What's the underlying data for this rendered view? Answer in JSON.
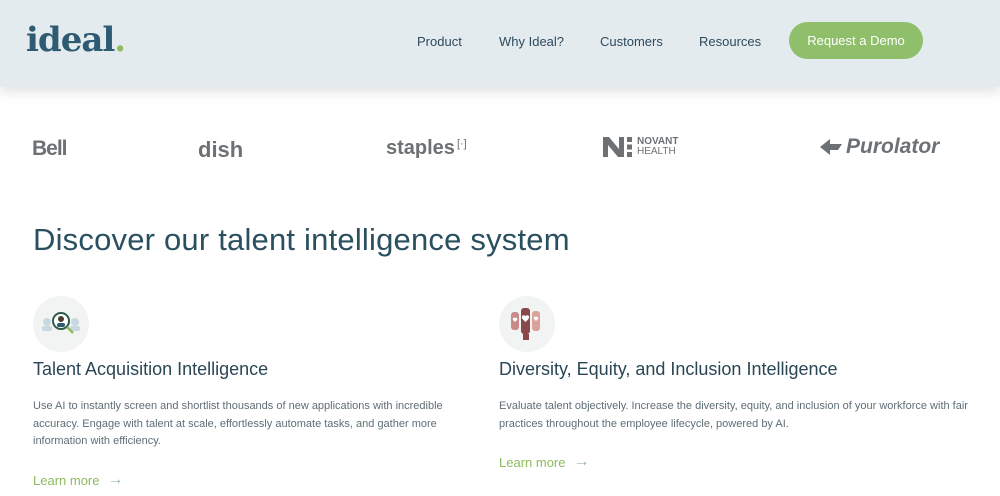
{
  "brand": {
    "name": "ideal",
    "dot": "."
  },
  "nav": {
    "items": [
      "Product",
      "Why Ideal?",
      "Customers",
      "Resources"
    ],
    "cta": "Request a Demo"
  },
  "clients": [
    "Bell",
    "dish",
    "staples",
    "NOVANT",
    "HEALTH",
    "Purolator"
  ],
  "main": {
    "heading": "Discover our talent intelligence system",
    "cards": [
      {
        "title": "Talent Acquisition Intelligence",
        "description": "Use AI to instantly screen and shortlist thousands of new applications with incredible accuracy. Engage with talent at scale, effortlessly automate tasks, and gather more information with efficiency.",
        "link": "Learn more"
      },
      {
        "title": "Diversity, Equity, and Inclusion Intelligence",
        "description": "Evaluate talent objectively. Increase the diversity, equity, and inclusion of your workforce with fair practices throughout the employee lifecycle, powered by AI.",
        "link": "Learn more"
      }
    ]
  },
  "colors": {
    "brand_green": "#8dbb5e",
    "brand_blue": "#2e5a72",
    "header_bg": "#e3ebef"
  }
}
